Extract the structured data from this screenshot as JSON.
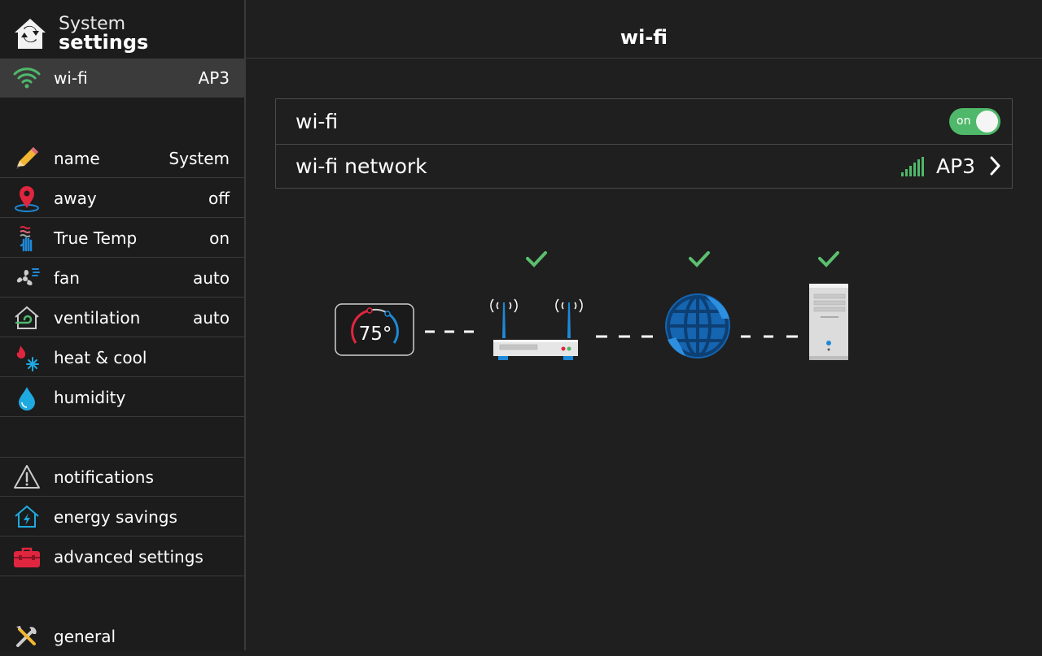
{
  "sidebar": {
    "header": {
      "line1": "System",
      "line2": "settings"
    },
    "items": [
      {
        "label": "wi-fi",
        "value": "AP3",
        "icon": "wifi-icon"
      },
      {
        "label": "name",
        "value": "System",
        "icon": "pencil-icon"
      },
      {
        "label": "away",
        "value": "off",
        "icon": "location-pin-icon"
      },
      {
        "label": "True Temp",
        "value": "on",
        "icon": "hand-heat-icon"
      },
      {
        "label": "fan",
        "value": "auto",
        "icon": "fan-icon"
      },
      {
        "label": "ventilation",
        "value": "auto",
        "icon": "house-airflow-icon"
      },
      {
        "label": "heat & cool",
        "value": "",
        "icon": "flame-snowflake-icon"
      },
      {
        "label": "humidity",
        "value": "",
        "icon": "water-drop-icon"
      },
      {
        "label": "notifications",
        "value": "",
        "icon": "warning-triangle-icon"
      },
      {
        "label": "energy savings",
        "value": "",
        "icon": "house-bolt-icon"
      },
      {
        "label": "advanced settings",
        "value": "",
        "icon": "toolbox-icon"
      },
      {
        "label": "general",
        "value": "",
        "icon": "tools-icon"
      }
    ]
  },
  "main": {
    "title": "wi-fi",
    "wifi_row": {
      "label": "wi-fi",
      "toggle_text": "on"
    },
    "network_row": {
      "label": "wi-fi network",
      "value": "AP3"
    },
    "diagram": {
      "thermostat_temp": "75°"
    }
  },
  "colors": {
    "accent_green": "#4fb86a",
    "checkmark_green": "#5cbf6f",
    "background": "#1f1f1f",
    "active_row": "#3b3b3b",
    "red": "#e0263f",
    "blue": "#1e88d8"
  }
}
